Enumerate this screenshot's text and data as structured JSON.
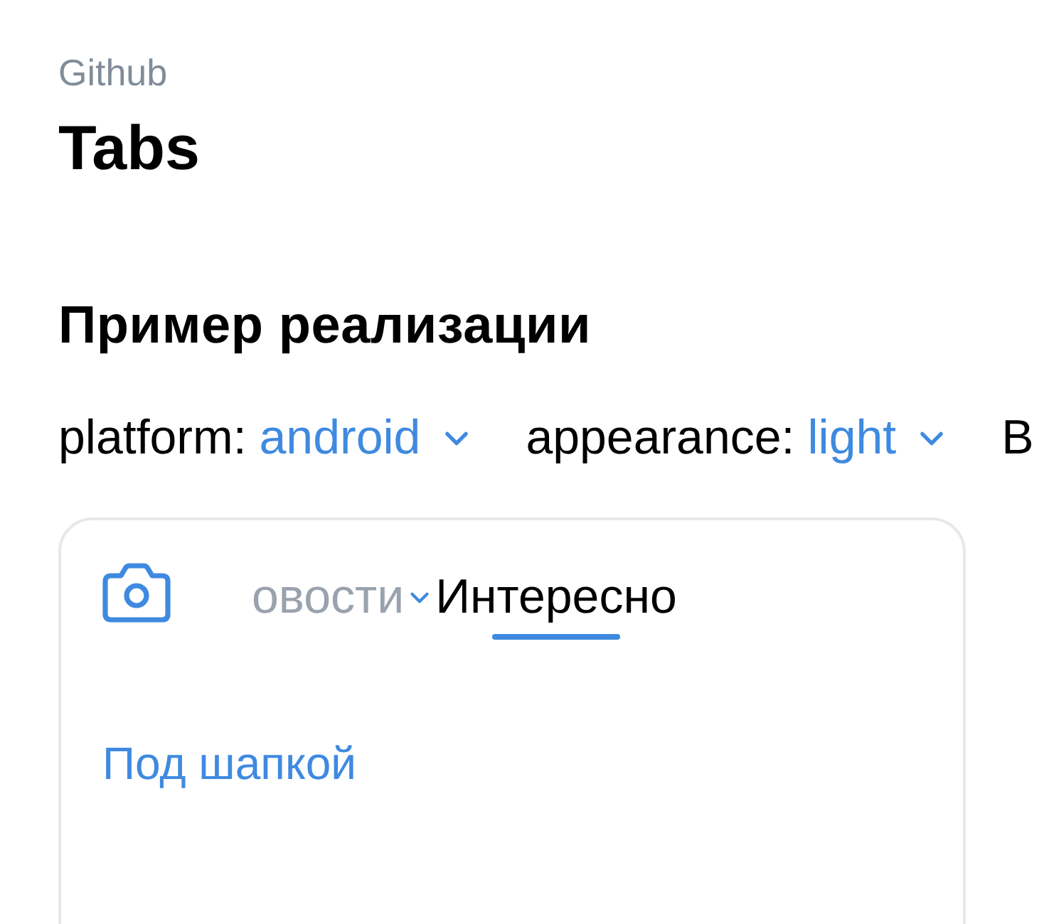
{
  "header": {
    "source": "Github",
    "title": "Tabs"
  },
  "section": {
    "title": "Пример реализации"
  },
  "selectors": [
    {
      "label": "platform:",
      "value": "android"
    },
    {
      "label": "appearance:",
      "value": "light"
    },
    {
      "label": "В"
    }
  ],
  "example": {
    "tabs": [
      {
        "label": "овости",
        "selected": false,
        "has_menu": true
      },
      {
        "label": "Интересно",
        "selected": true,
        "has_menu": false
      }
    ],
    "content": "Под шапкой"
  }
}
